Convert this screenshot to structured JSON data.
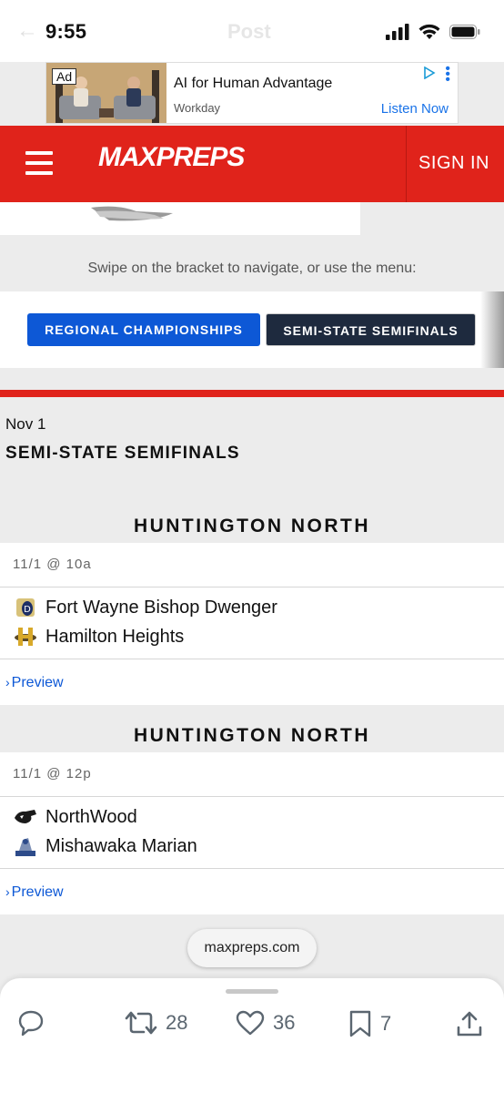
{
  "status": {
    "time": "9:55",
    "ghost_title": "Post"
  },
  "ad": {
    "badge": "Ad",
    "title": "AI for Human Advantage",
    "sponsor": "Workday",
    "cta": "Listen Now"
  },
  "nav": {
    "logo": "MAXPREPS",
    "signin": "SIGN IN",
    "brand_color": "#e0231b"
  },
  "bracket": {
    "swipe_hint": "Swipe on the bracket to navigate, or use the menu:",
    "tabs": [
      {
        "label": "REGIONAL CHAMPIONSHIPS"
      },
      {
        "label": "SEMI-STATE SEMIFINALS"
      }
    ],
    "date": "Nov 1",
    "round": "SEMI-STATE SEMIFINALS",
    "games": [
      {
        "venue": "HUNTINGTON NORTH",
        "time": "11/1 @ 10a",
        "team1": "Fort Wayne Bishop Dwenger",
        "team2": "Hamilton Heights",
        "preview": "Preview"
      },
      {
        "venue": "HUNTINGTON NORTH",
        "time": "11/1 @ 12p",
        "team1": "NorthWood",
        "team2": "Mishawaka Marian",
        "preview": "Preview"
      }
    ]
  },
  "browser": {
    "url": "maxpreps.com"
  },
  "post_actions": {
    "retweets": "28",
    "likes": "36",
    "bookmarks": "7"
  }
}
